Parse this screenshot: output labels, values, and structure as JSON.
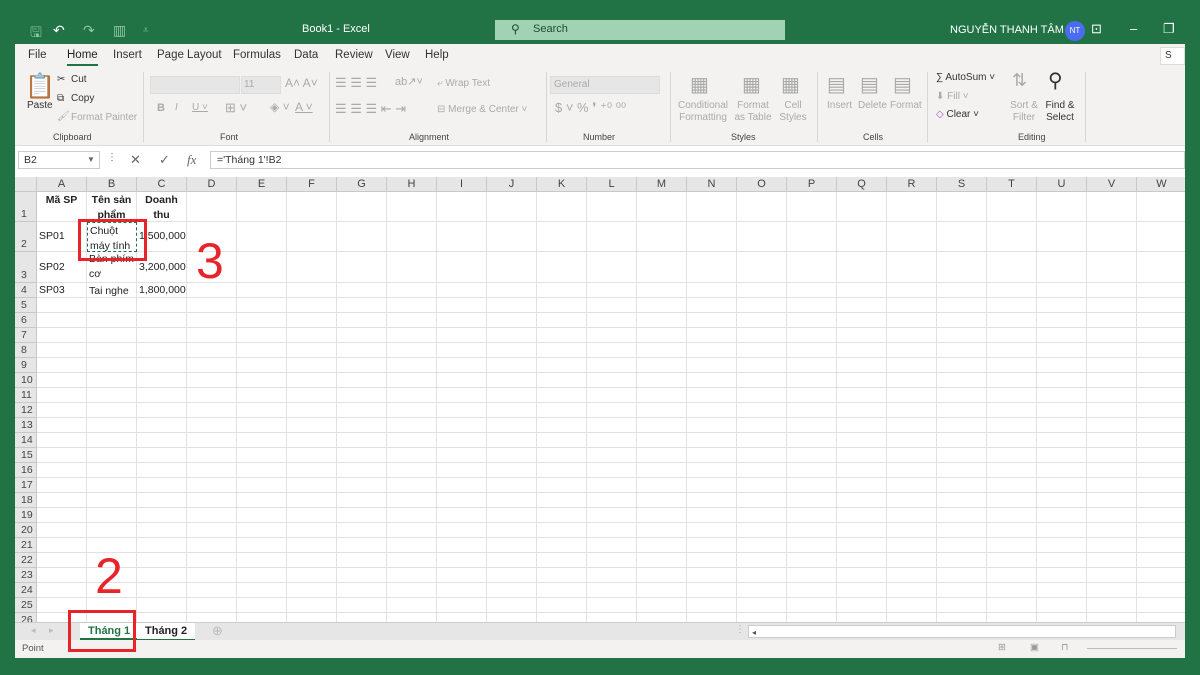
{
  "titlebar": {
    "title": "Book1  -  Excel",
    "search_placeholder": "Search",
    "user": "NGUYỄN THANH TÂM",
    "avatar_initials": "NT"
  },
  "ribbon_tabs": [
    "File",
    "Home",
    "Insert",
    "Page Layout",
    "Formulas",
    "Data",
    "Review",
    "View",
    "Help"
  ],
  "active_tab": "Home",
  "ribbon": {
    "clipboard": {
      "paste": "Paste",
      "cut": "Cut",
      "copy": "Copy",
      "format_painter": "Format Painter",
      "label": "Clipboard"
    },
    "font": {
      "size": "11",
      "label": "Font"
    },
    "alignment": {
      "wrap_text": "Wrap Text",
      "merge_center": "Merge & Center",
      "label": "Alignment"
    },
    "number": {
      "format": "General",
      "label": "Number"
    },
    "styles": {
      "conditional": "Conditional Formatting",
      "format_table": "Format as Table",
      "cell_styles": "Cell Styles",
      "label": "Styles"
    },
    "cells": {
      "insert": "Insert",
      "delete": "Delete",
      "format": "Format",
      "label": "Cells"
    },
    "editing": {
      "autosum": "AutoSum",
      "fill": "Fill",
      "clear": "Clear",
      "sort_filter": "Sort & Filter",
      "find_select": "Find & Select",
      "label": "Editing"
    },
    "share": "S"
  },
  "formula_bar": {
    "name_box": "B2",
    "formula": "='Tháng 1'!B2"
  },
  "columns": [
    "A",
    "B",
    "C",
    "D",
    "E",
    "F",
    "G",
    "H",
    "I",
    "J",
    "K",
    "L",
    "M",
    "N",
    "O",
    "P",
    "Q",
    "R",
    "S",
    "T",
    "U",
    "V",
    "W"
  ],
  "rows": [
    "1",
    "2",
    "3",
    "4",
    "5",
    "6",
    "7",
    "8",
    "9",
    "10",
    "11",
    "12",
    "13",
    "14",
    "15",
    "16",
    "17",
    "18",
    "19",
    "20",
    "21",
    "22",
    "23",
    "24",
    "25",
    "26"
  ],
  "cells": {
    "A1": "Mã SP",
    "B1": "Tên sản phẩm",
    "C1": "Doanh thu",
    "A2": "SP01",
    "B2": "Chuột máy tính",
    "C2": "1,500,000",
    "A3": "SP02",
    "B3": "Bàn phím cơ",
    "C3": "3,200,000",
    "A4": "SP03",
    "B4": "Tai nghe",
    "C4": "1,800,000"
  },
  "sheets": [
    "Tháng 1",
    "Tháng 2"
  ],
  "active_sheet": "Tháng 1",
  "status": {
    "mode": "Point"
  },
  "annotations": [
    "3",
    "2"
  ],
  "colors": {
    "brand": "#217346",
    "annotation": "#e8242b"
  }
}
